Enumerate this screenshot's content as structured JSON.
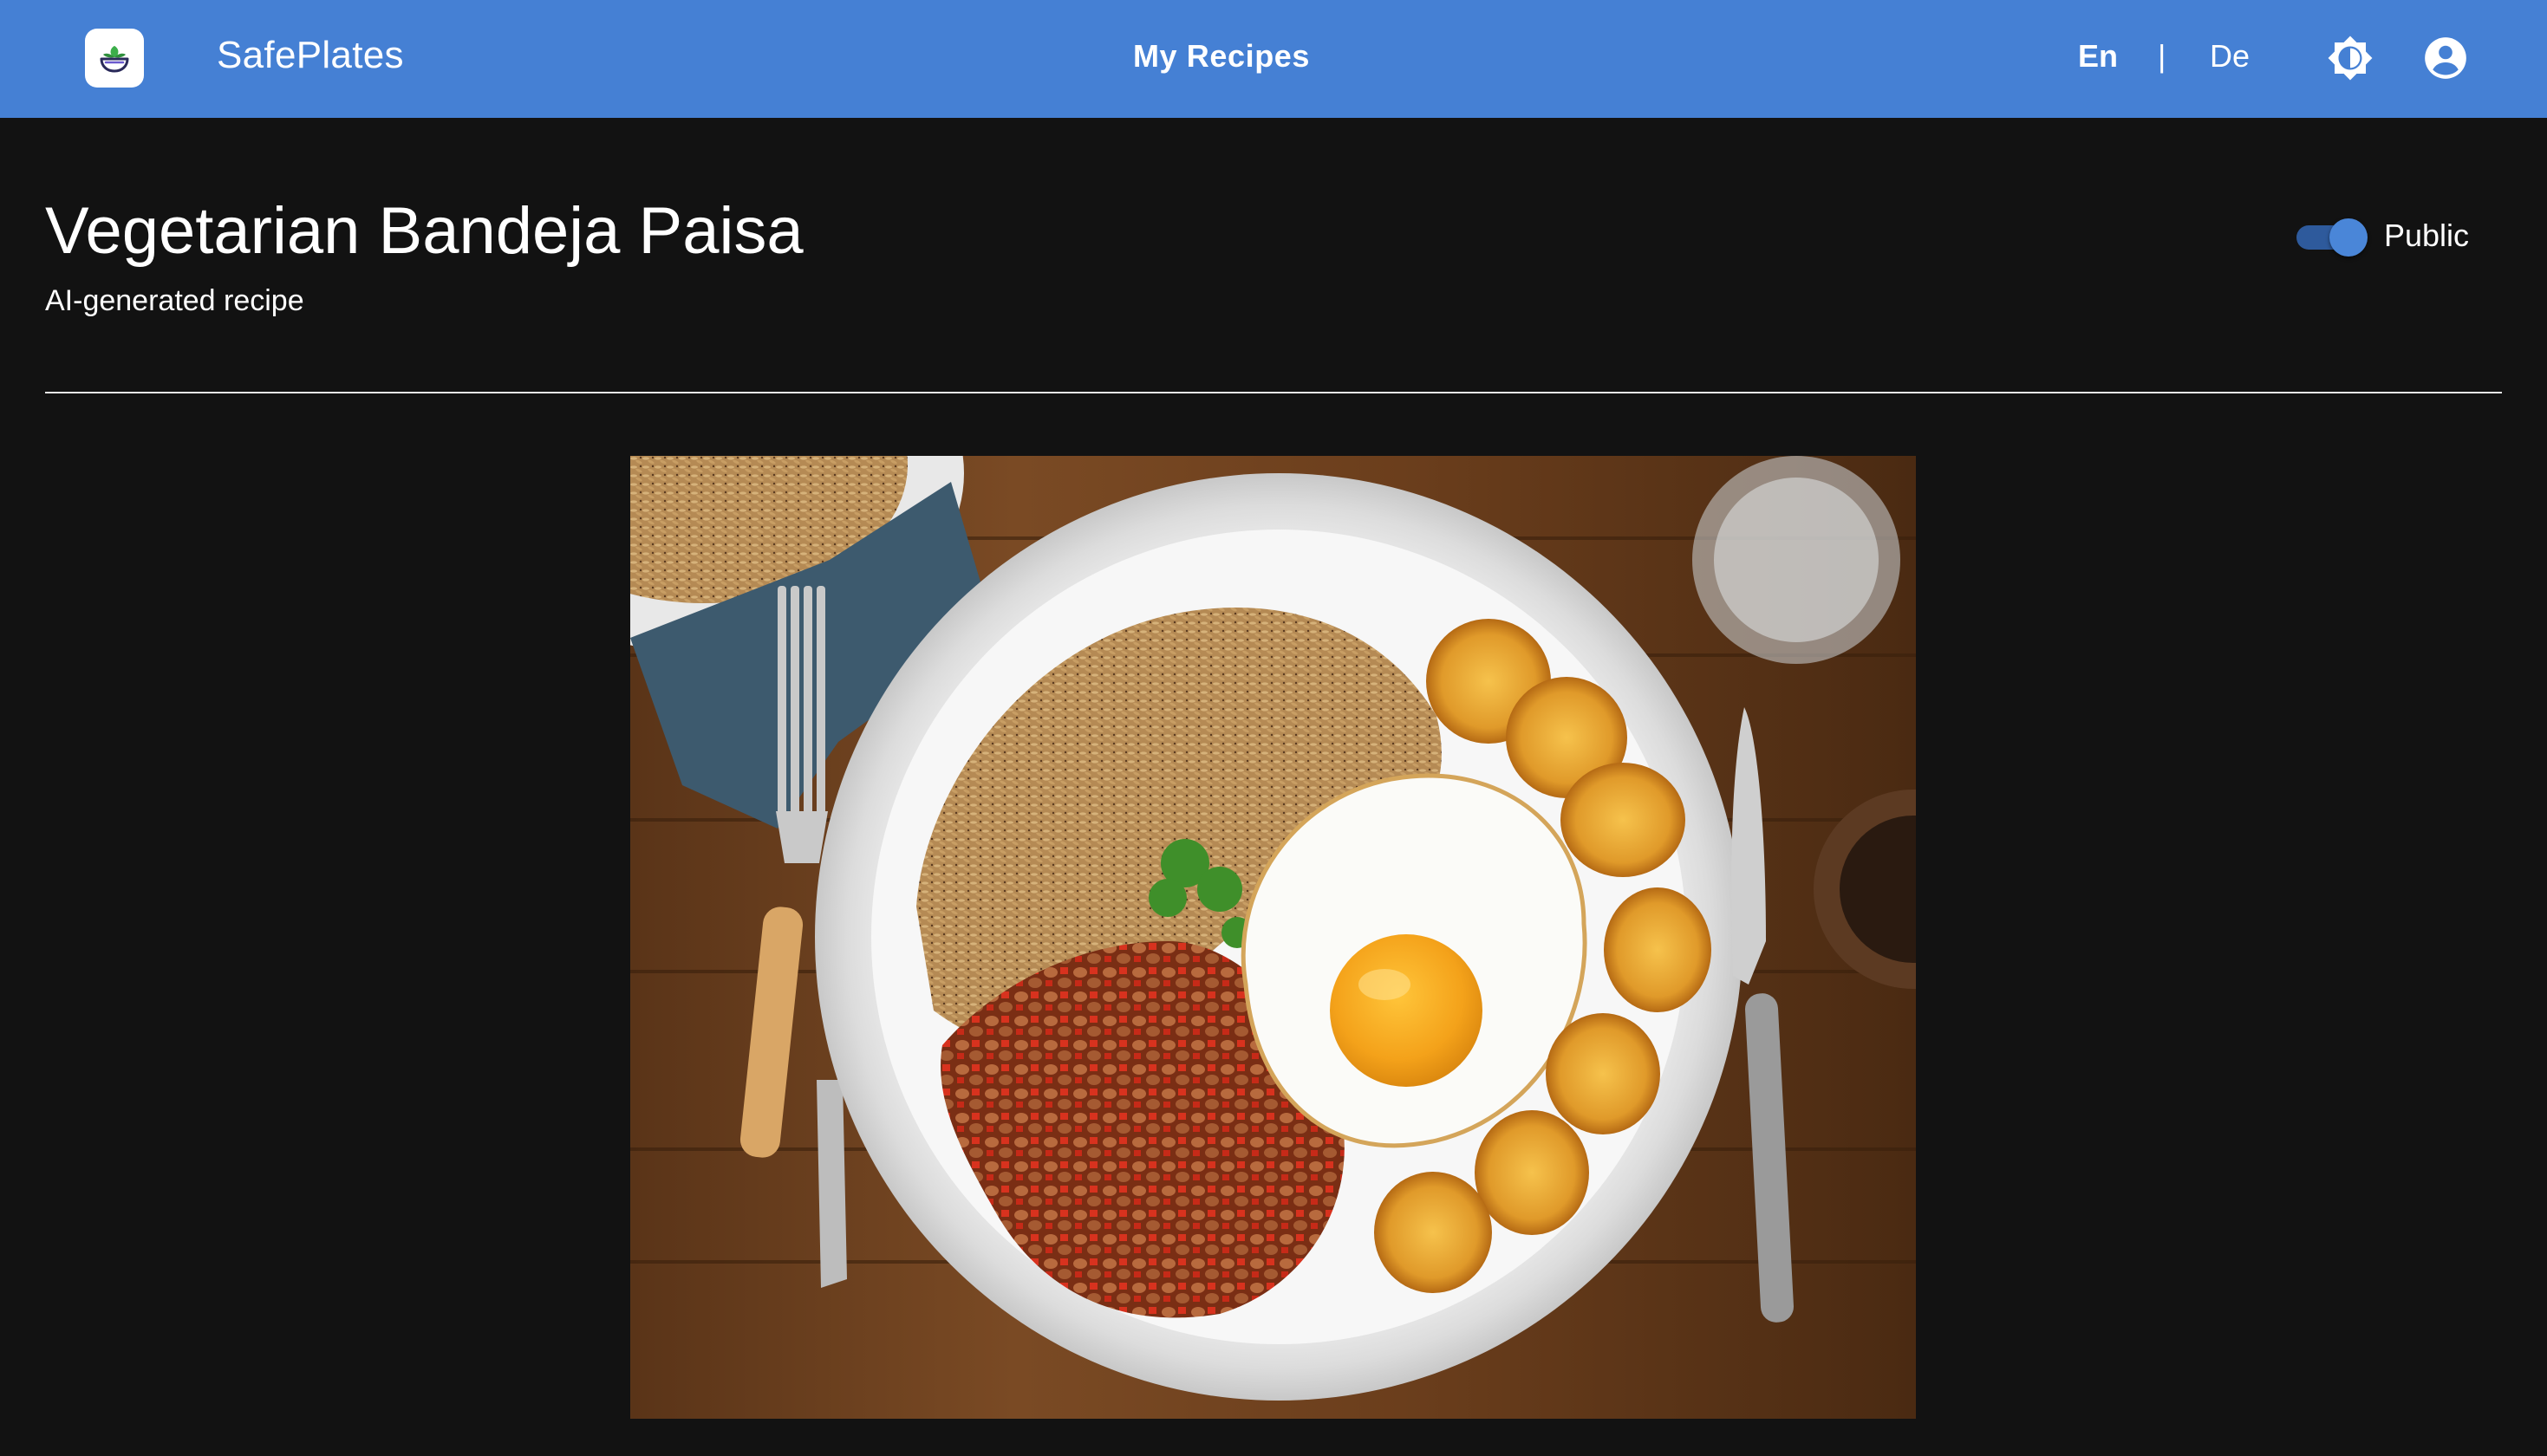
{
  "app": {
    "name": "SafePlates",
    "logo_icon": "bowl-plant-icon"
  },
  "nav": {
    "center_link": "My Recipes",
    "language": {
      "options": [
        "En",
        "De"
      ],
      "selected": "En",
      "separator": "|"
    },
    "theme_icon": "brightness-icon",
    "account_icon": "account-circle-icon"
  },
  "recipe": {
    "title": "Vegetarian Bandeja Paisa",
    "subtitle": "AI-generated recipe",
    "visibility_label": "Public",
    "visibility_on": true,
    "image_alt": "Vegetarian Bandeja Paisa"
  },
  "colors": {
    "topbar": "#4580d4",
    "background": "#121212",
    "toggle_on": "#4a86d8"
  }
}
